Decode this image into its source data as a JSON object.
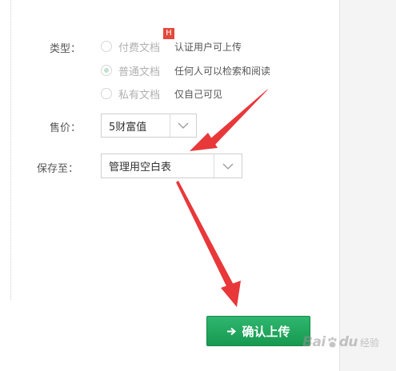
{
  "form": {
    "type_label": "类型：",
    "type_options": [
      {
        "label": "付费文档",
        "description": "认证用户可上传",
        "checked": false,
        "badge": "H"
      },
      {
        "label": "普通文档",
        "description": "任何人可以检索和阅读",
        "checked": true
      },
      {
        "label": "私有文档",
        "description": "仅自己可见",
        "checked": false
      }
    ],
    "price_label": "售价：",
    "price_value": "5财富值",
    "save_label": "保存至：",
    "save_value": "管理用空白表",
    "submit_label": "确认上传"
  },
  "watermark": {
    "brand": "Bai",
    "brand_suffix": "du",
    "text": "经验"
  },
  "colors": {
    "submit_green": "#1ea85a",
    "annotation_red": "#e8383a",
    "badge_red": "#e24a3b"
  },
  "icons": {
    "submit_arrow": "arrow-right-icon",
    "select_arrow": "chevron-down-icon"
  }
}
